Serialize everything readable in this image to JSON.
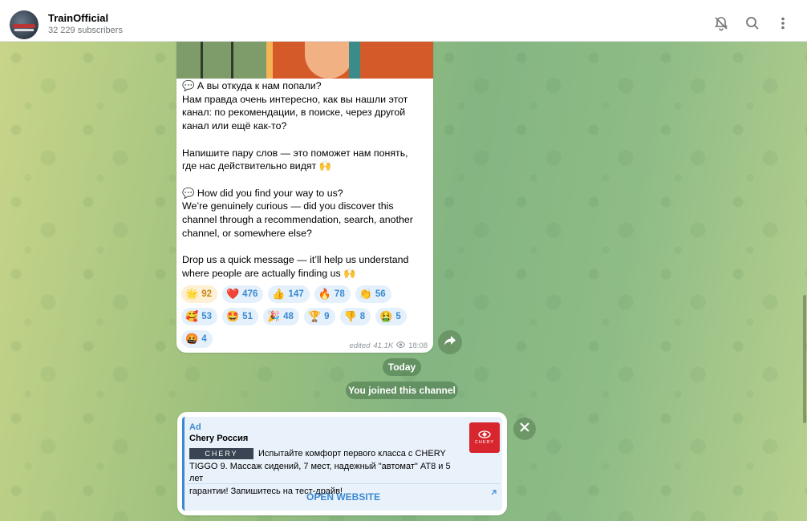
{
  "header": {
    "channel_name": "TrainOfficial",
    "subscribers": "32 229 subscribers",
    "icons": [
      "bell-muted-icon",
      "search-icon",
      "more-vertical-icon"
    ]
  },
  "message": {
    "lines": [
      "💬 А вы откуда к нам попали?",
      "Нам правда очень интересно, как вы нашли этот",
      "канал: по рекомендации, в поиске, через другой",
      "канал или ещё как-то?",
      "",
      "Напишите пару слов — это поможет нам понять,",
      "где нас действительно видят 🙌",
      "",
      "💬 How did you find your way to us?",
      "We’re genuinely curious — did you discover this",
      "channel through a recommendation, search, another",
      "channel, or somewhere else?",
      "",
      "Drop us a quick message — it’ll help us understand",
      "where people are actually finding us 🙌"
    ],
    "reactions": [
      [
        {
          "emoji": "🌟",
          "count": "92",
          "active": true
        },
        {
          "emoji": "❤️",
          "count": "476"
        },
        {
          "emoji": "👍",
          "count": "147"
        },
        {
          "emoji": "🔥",
          "count": "78"
        },
        {
          "emoji": "👏",
          "count": "56"
        }
      ],
      [
        {
          "emoji": "🥰",
          "count": "53"
        },
        {
          "emoji": "🤩",
          "count": "51"
        },
        {
          "emoji": "🎉",
          "count": "48"
        },
        {
          "emoji": "🏆",
          "count": "9"
        },
        {
          "emoji": "👎",
          "count": "8"
        },
        {
          "emoji": "🤮",
          "count": "5"
        }
      ],
      [
        {
          "emoji": "🤬",
          "count": "4"
        }
      ]
    ],
    "edited_label": "edited",
    "views": "41.1K",
    "time": "18:08"
  },
  "service": {
    "date": "Today",
    "joined": "You joined this channel"
  },
  "ad": {
    "label": "Ad",
    "sponsor": "Chery Россия",
    "brand_logo_text": "CHERY",
    "line1": "Испытайте комфорт первого класса с CHERY",
    "line2": "TIGGO 9. Массаж сидений, 7 мест, надежный \"автомат\" AT8 и 5 лет",
    "line3": "гарантии! Запишитесь на тест-драйв!",
    "button": "OPEN WEBSITE",
    "thumb_text": "CHERY",
    "colors": {
      "accent": "#3a89d1",
      "brand": "#d8262f"
    }
  }
}
